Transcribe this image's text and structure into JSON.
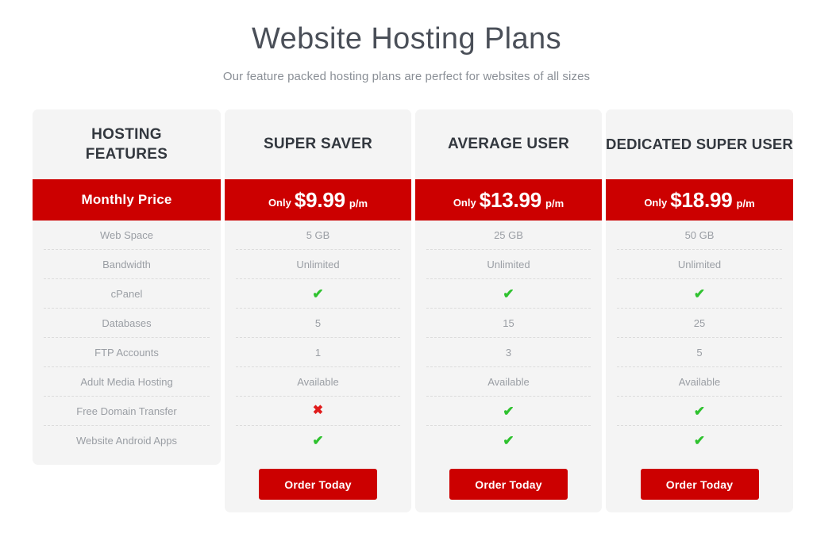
{
  "header": {
    "title": "Website Hosting Plans",
    "subtitle": "Our feature packed hosting plans are perfect for websites of all sizes"
  },
  "colors": {
    "brand_red": "#cc0000",
    "check_green": "#2fc22f",
    "cross_red": "#e01b1b",
    "card_background": "#f4f4f4",
    "page_background": "#ffffff",
    "heading_text": "#33383f",
    "body_text": "#9a9ea4"
  },
  "features_column": {
    "header_line1": "HOSTING",
    "header_line2": "FEATURES",
    "price_row_label": "Monthly Price",
    "rows": [
      "Web Space",
      "Bandwidth",
      "cPanel",
      "Databases",
      "FTP Accounts",
      "Adult Media Hosting",
      "Free Domain Transfer",
      "Website Android Apps"
    ]
  },
  "plans": [
    {
      "name": "SUPER SAVER",
      "price_prefix": "Only",
      "price": "$9.99",
      "price_period": "p/m",
      "values": [
        "5 GB",
        "Unlimited",
        "check",
        "5",
        "1",
        "Available",
        "cross",
        "check"
      ],
      "cta_label": "Order Today"
    },
    {
      "name": "AVERAGE USER",
      "price_prefix": "Only",
      "price": "$13.99",
      "price_period": "p/m",
      "values": [
        "25 GB",
        "Unlimited",
        "check",
        "15",
        "3",
        "Available",
        "check",
        "check"
      ],
      "cta_label": "Order Today"
    },
    {
      "name": "DEDICATED SUPER USER",
      "price_prefix": "Only",
      "price": "$18.99",
      "price_period": "p/m",
      "values": [
        "50 GB",
        "Unlimited",
        "check",
        "25",
        "5",
        "Available",
        "check",
        "check"
      ],
      "cta_label": "Order Today"
    }
  ],
  "icons": {
    "check": "✔",
    "cross": "✖"
  }
}
